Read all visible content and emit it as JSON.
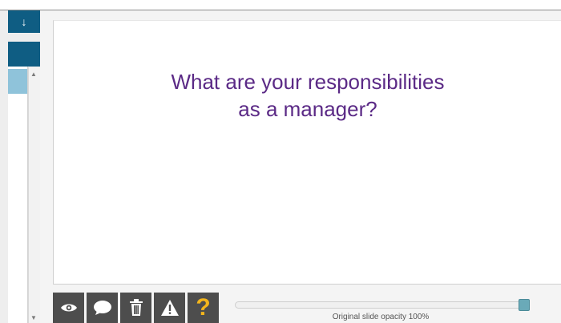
{
  "slide": {
    "title_line1": "What are your responsibilities",
    "title_line2": "as a manager?"
  },
  "left_panel": {
    "top_button_glyph": "↓",
    "scroll_up_glyph": "▲",
    "scroll_down_glyph": "▼"
  },
  "toolbar": {
    "buttons": [
      {
        "icon": "eye-icon"
      },
      {
        "icon": "speech-bubble-icon"
      },
      {
        "icon": "trash-icon"
      },
      {
        "icon": "warning-icon"
      },
      {
        "icon": "help-icon",
        "glyph": "?"
      }
    ]
  },
  "opacity_slider": {
    "label": "Original slide opacity 100%",
    "value_percent": 100
  },
  "colors": {
    "title": "#5b2a86",
    "teal": "#0f5d83",
    "selected_thumb": "#8fc3da",
    "toolbar": "#4d4d4d",
    "help_glyph": "#f3b51c",
    "slider_thumb": "#6aaab8"
  }
}
